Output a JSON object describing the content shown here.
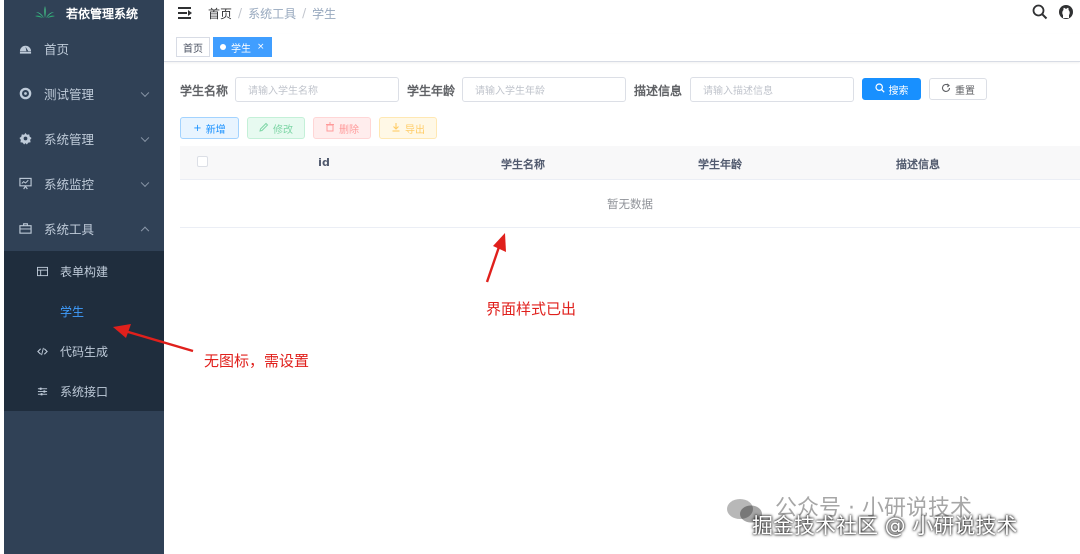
{
  "app": {
    "title": "若依管理系统"
  },
  "sidebar": {
    "items": [
      {
        "label": "首页",
        "icon": "dashboard-icon",
        "expanded": false
      },
      {
        "label": "测试管理",
        "icon": "gear-icon",
        "expanded": false
      },
      {
        "label": "系统管理",
        "icon": "system-icon",
        "expanded": false
      },
      {
        "label": "系统监控",
        "icon": "monitor-icon",
        "expanded": false
      },
      {
        "label": "系统工具",
        "icon": "tool-icon",
        "expanded": true
      }
    ],
    "submenu": [
      {
        "label": "表单构建",
        "icon": "form-build-icon",
        "active": false
      },
      {
        "label": "学生",
        "icon": "",
        "active": true
      },
      {
        "label": "代码生成",
        "icon": "code-icon",
        "active": false
      },
      {
        "label": "系统接口",
        "icon": "api-icon",
        "active": false
      }
    ]
  },
  "navbar": {
    "breadcrumb": [
      "首页",
      "系统工具",
      "学生"
    ],
    "separator": "/"
  },
  "tags": [
    {
      "label": "首页",
      "active": false
    },
    {
      "label": "学生",
      "active": true,
      "close": "×"
    }
  ],
  "search": {
    "fields": [
      {
        "label": "学生名称",
        "placeholder": "请输入学生名称"
      },
      {
        "label": "学生年龄",
        "placeholder": "请输入学生年龄"
      },
      {
        "label": "描述信息",
        "placeholder": "请输入描述信息"
      }
    ],
    "search_label": "搜索",
    "reset_label": "重置"
  },
  "toolbar": {
    "add_label": "新增",
    "edit_label": "修改",
    "delete_label": "删除",
    "export_label": "导出"
  },
  "table": {
    "columns": [
      "id",
      "学生名称",
      "学生年龄",
      "描述信息"
    ],
    "empty_text": "暂无数据"
  },
  "annotations": {
    "style_note": "界面样式已出",
    "icon_note": "无图标，需设置"
  },
  "watermarks": {
    "wechat": "公众号 · 小研说技术",
    "juejin": "掘金技术社区 @ 小研说技术"
  },
  "colors": {
    "sidebar_bg": "#304156",
    "submenu_bg": "#1f2d3d",
    "primary": "#1890ff",
    "active_menu": "#409eff",
    "annotation": "#e0201c"
  }
}
